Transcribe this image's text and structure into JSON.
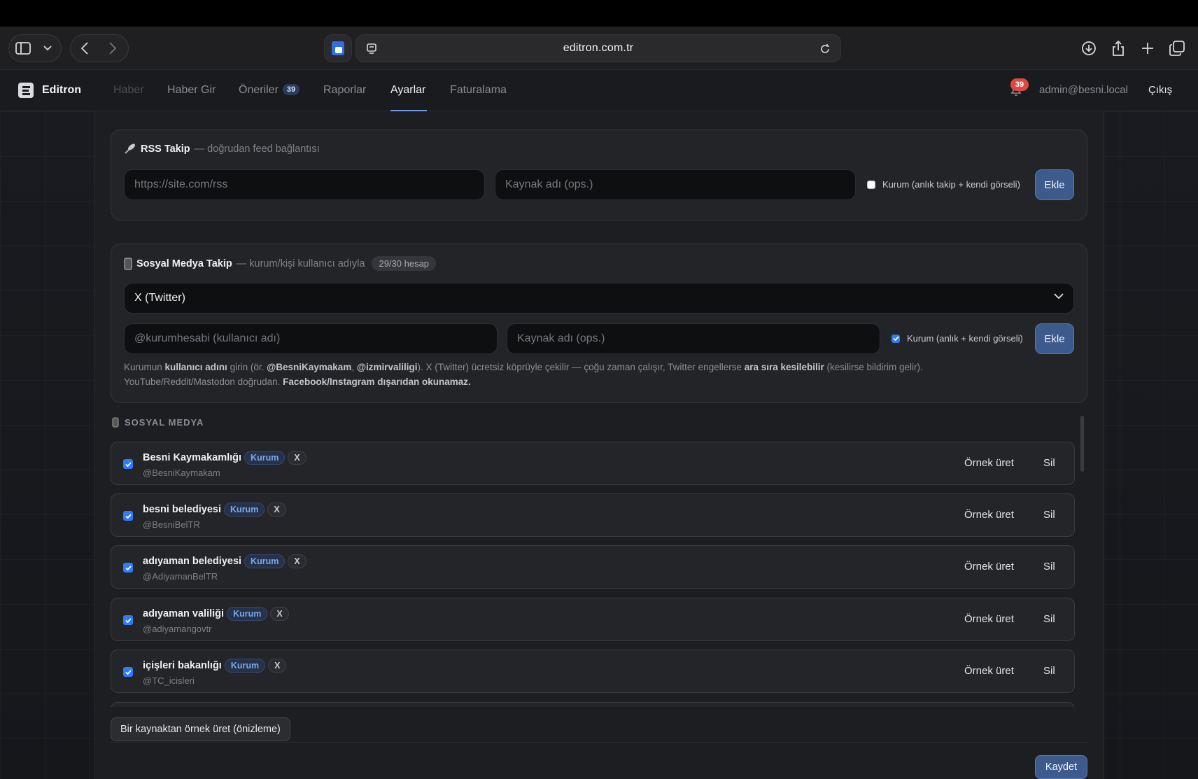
{
  "browser": {
    "url": "editron.com.tr"
  },
  "nav": {
    "brand": "Editron",
    "items": [
      {
        "label": "Haber"
      },
      {
        "label": "Haber Gir"
      },
      {
        "label": "Öneriler",
        "badge": "39"
      },
      {
        "label": "Raporlar"
      },
      {
        "label": "Ayarlar",
        "active": true
      },
      {
        "label": "Faturalama"
      }
    ],
    "notification_count": "39",
    "user_email": "admin@besni.local",
    "logout_label": "Çıkış"
  },
  "rss": {
    "title": "RSS Takip",
    "subtitle": "— doğrudan feed bağlantısı",
    "url_placeholder": "https://site.com/rss",
    "name_placeholder": "Kaynak adı (ops.)",
    "checkbox_label": "Kurum (anlık takip + kendi görseli)",
    "checkbox_checked": false,
    "add_label": "Ekle"
  },
  "social": {
    "title": "Sosyal Medya Takip",
    "subtitle": "— kurum/kişi kullanıcı adıyla",
    "quota": "29/30 hesap",
    "platform_selected": "X (Twitter)",
    "handle_placeholder": "@kurumhesabi (kullanıcı adı)",
    "name_placeholder": "Kaynak adı (ops.)",
    "checkbox_label": "Kurum (anlık + kendi görseli)",
    "checkbox_checked": true,
    "add_label": "Ekle",
    "help": {
      "p1": "Kurumun ",
      "b1": "kullanıcı adını",
      "p2": " girin (ör. ",
      "b2": "@BesniKaymakam",
      "p3": ", ",
      "b3": "@izmirvaliligi",
      "p4": "). X (Twitter) ücretsiz köprüyle çekilir — çoğu zaman çalışır, Twitter engellerse ",
      "b4": "ara sıra kesilebilir",
      "p5": " (kesilirse bildirim gelir).",
      "p6": "YouTube/Reddit/Mastodon doğrudan. ",
      "b5": "Facebook/Instagram dışarıdan okunamaz."
    }
  },
  "list": {
    "section_title": "SOSYAL MEDYA",
    "generate_label": "Örnek üret",
    "delete_label": "Sil",
    "items": [
      {
        "name": "Besni Kaymakamlığı",
        "handle": "@BesniKaymakam",
        "tag_kurum": "Kurum",
        "tag_platform": "X",
        "checked": true
      },
      {
        "name": "besni belediyesi",
        "handle": "@BesniBelTR",
        "tag_kurum": "Kurum",
        "tag_platform": "X",
        "checked": true
      },
      {
        "name": "adıyaman belediyesi",
        "handle": "@AdiyamanBelTR",
        "tag_kurum": "Kurum",
        "tag_platform": "X",
        "checked": true
      },
      {
        "name": "adıyaman valiliği",
        "handle": "@adiyamangovtr",
        "tag_kurum": "Kurum",
        "tag_platform": "X",
        "checked": true
      },
      {
        "name": "içişleri bakanlığı",
        "handle": "@TC_icisleri",
        "tag_kurum": "Kurum",
        "tag_platform": "X",
        "checked": true
      }
    ]
  },
  "footer": {
    "preview_label": "Bir kaynaktan örnek üret (önizleme)",
    "save_label": "Kaydet"
  },
  "colors": {
    "accent": "#3c5a8c",
    "checkbox": "#2f7cf6",
    "badge_red": "#e0483e"
  }
}
